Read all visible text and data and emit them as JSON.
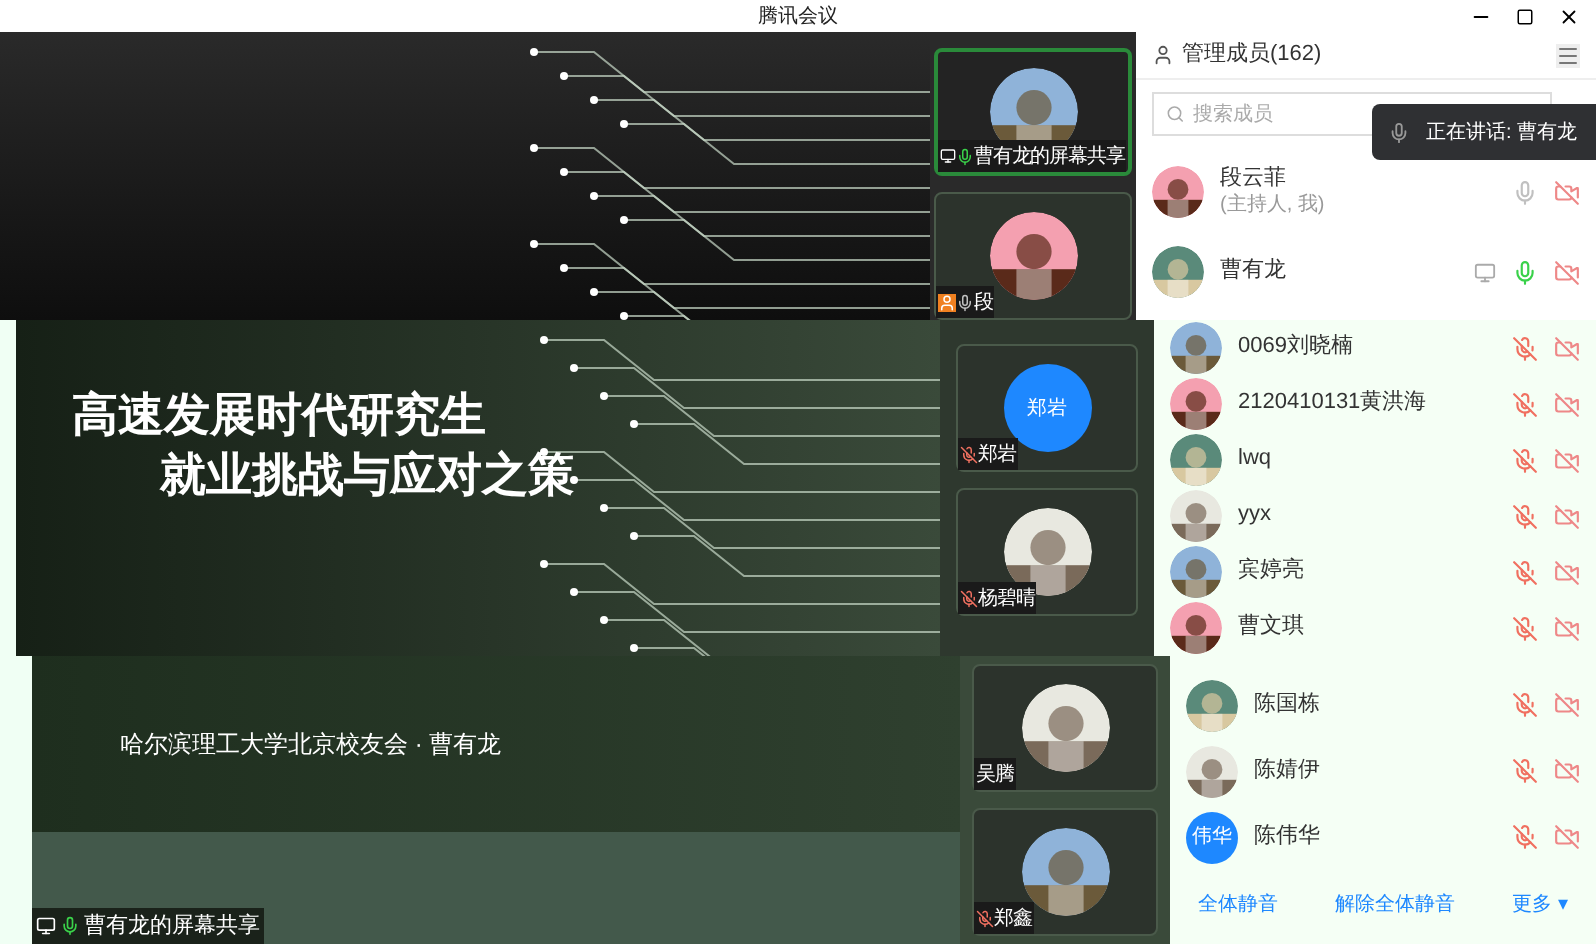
{
  "window": {
    "title": "腾讯会议"
  },
  "top": {
    "tiles": [
      {
        "name": "曹有龙的屏幕共享",
        "kind": "share",
        "muted": false,
        "speaking": true,
        "active": true
      },
      {
        "name": "段",
        "kind": "host",
        "muted": false,
        "speaking": false,
        "active": false
      }
    ],
    "panel": {
      "title": "管理成员(162)",
      "search": {
        "placeholder": "搜索成员"
      },
      "toast": "正在讲话: 曹有龙",
      "members": [
        {
          "name": "段云菲",
          "note": "(主持人, 我)",
          "muted": false,
          "speaking": false,
          "sharing": false
        },
        {
          "name": "曹有龙",
          "muted": false,
          "speaking": true,
          "sharing": true
        }
      ]
    }
  },
  "middle": {
    "slide": {
      "title_lines": [
        "高速发展时代研究生",
        "就业挑战与应对之策"
      ]
    },
    "tiles": [
      {
        "name": "郑岩",
        "muted": true,
        "speaking": false,
        "avatar": {
          "kind": "text",
          "text": "郑岩"
        }
      },
      {
        "name": "杨碧晴",
        "muted": true,
        "speaking": false
      }
    ],
    "members": [
      {
        "name": "0069刘晓楠",
        "muted": true,
        "speaking": false
      },
      {
        "name": "2120410131黄洪海",
        "muted": true,
        "speaking": false
      },
      {
        "name": "lwq",
        "muted": true,
        "speaking": false
      },
      {
        "name": "yyx",
        "muted": true,
        "speaking": false
      },
      {
        "name": "宾婷亮",
        "muted": true,
        "speaking": false
      },
      {
        "name": "曹文琪",
        "muted": true,
        "speaking": false
      }
    ]
  },
  "bottom": {
    "slide": {
      "subtitle": "哈尔滨理工大学北京校友会 · 曹有龙"
    },
    "share_label": "曹有龙的屏幕共享",
    "tiles": [
      {
        "name": "吴腾"
      },
      {
        "name": "郑鑫",
        "muted": true,
        "speaking": false
      }
    ],
    "members": [
      {
        "name": "陈国栋",
        "muted": true,
        "speaking": false
      },
      {
        "name": "陈婧伊",
        "muted": true,
        "speaking": false
      },
      {
        "name": "陈伟华",
        "muted": true,
        "speaking": false,
        "avatar": {
          "kind": "text",
          "text": "伟华"
        }
      }
    ],
    "footer": [
      "全体静音",
      "解除全体静音",
      "更多 ▾"
    ]
  }
}
